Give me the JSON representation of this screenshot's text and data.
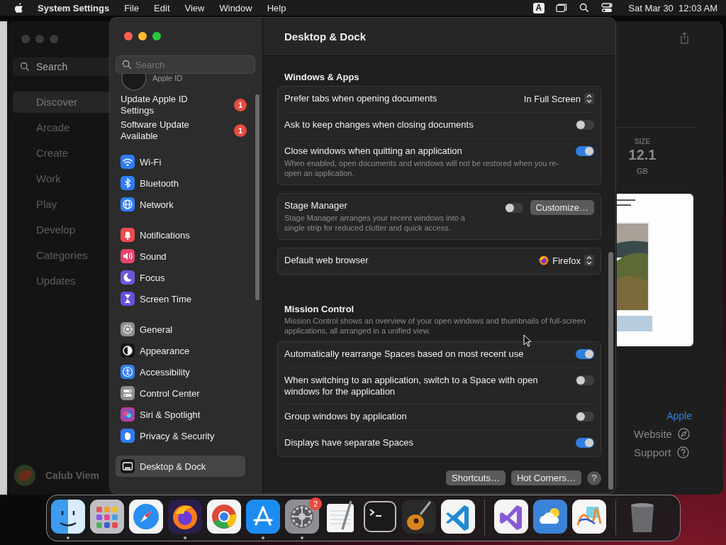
{
  "menu_bar": {
    "app": "System Settings",
    "menus": [
      "File",
      "Edit",
      "View",
      "Window",
      "Help"
    ],
    "input_source": "A",
    "clock": "Sat Mar 30  12:03 AM"
  },
  "background_window": {
    "search": {
      "placeholder": "Search"
    },
    "nav": [
      {
        "label": "Discover",
        "selected": true
      },
      {
        "label": "Arcade",
        "selected": false
      },
      {
        "label": "Create",
        "selected": false
      },
      {
        "label": "Work",
        "selected": false
      },
      {
        "label": "Play",
        "selected": false
      },
      {
        "label": "Develop",
        "selected": false
      },
      {
        "label": "Categories",
        "selected": false
      },
      {
        "label": "Updates",
        "selected": false
      }
    ],
    "user": "Calub Viem",
    "size_label": "SIZE",
    "size_value": "12.1",
    "size_unit": "GB",
    "developer": "Apple",
    "links": [
      "Website",
      "Support"
    ]
  },
  "settings": {
    "search": {
      "placeholder": "Search"
    },
    "account": "Apple ID",
    "alerts": [
      {
        "label": "Update Apple ID Settings",
        "badge": "1"
      },
      {
        "label": "Software Update Available",
        "badge": "1"
      }
    ],
    "groups": [
      [
        {
          "kind": "wifi",
          "label": "Wi-Fi",
          "color": "#2f7cf6",
          "selected": false
        },
        {
          "kind": "bluetooth",
          "label": "Bluetooth",
          "color": "#2f7cf6",
          "selected": false
        },
        {
          "kind": "network",
          "label": "Network",
          "color": "#2f7cf6",
          "selected": false
        }
      ],
      [
        {
          "kind": "notifications",
          "label": "Notifications",
          "color": "#ee4b4b",
          "selected": false
        },
        {
          "kind": "sound",
          "label": "Sound",
          "color": "#e8436a",
          "selected": false
        },
        {
          "kind": "focus",
          "label": "Focus",
          "color": "#6a5ad9",
          "selected": false
        },
        {
          "kind": "screen_time",
          "label": "Screen Time",
          "color": "#6a4fd9",
          "selected": false
        }
      ],
      [
        {
          "kind": "general",
          "label": "General",
          "color": "#8e8e93",
          "selected": false
        },
        {
          "kind": "appearance",
          "label": "Appearance",
          "color": "#161616",
          "selected": false
        },
        {
          "kind": "accessibility",
          "label": "Accessibility",
          "color": "#2f7cf6",
          "selected": false
        },
        {
          "kind": "control_center",
          "label": "Control Center",
          "color": "#8e8e93",
          "selected": false
        },
        {
          "kind": "siri",
          "label": "Siri & Spotlight",
          "color": "#b8409e",
          "selected": false
        },
        {
          "kind": "privacy",
          "label": "Privacy & Security",
          "color": "#2f7cf6",
          "selected": false
        }
      ],
      [
        {
          "kind": "desktop_dock",
          "label": "Desktop & Dock",
          "color": "#161616",
          "selected": true
        }
      ]
    ],
    "title": "Desktop & Dock",
    "sections": [
      {
        "heading": "Windows & Apps",
        "cards": [
          [
            {
              "kind": "popup",
              "label": "Prefer tabs when opening documents",
              "value": "In Full Screen"
            },
            {
              "kind": "toggle",
              "label": "Ask to keep changes when closing documents",
              "on": false
            },
            {
              "kind": "toggle",
              "label": "Close windows when quitting an application",
              "description": "When enabled, open documents and windows will not be restored when you re-open an application.",
              "on": true
            }
          ],
          [
            {
              "kind": "toggle",
              "label": "Stage Manager",
              "description": "Stage Manager arranges your recent windows into a single strip for reduced clutter and quick access.",
              "on": false,
              "button": "Customize…"
            }
          ],
          [
            {
              "kind": "app_popup",
              "label": "Default web browser",
              "value": "Firefox"
            }
          ]
        ]
      },
      {
        "heading": "Mission Control",
        "description": "Mission Control shows an overview of your open windows and thumbnails of full-screen applications, all arranged in a unified view.",
        "cards": [
          [
            {
              "kind": "toggle",
              "label": "Automatically rearrange Spaces based on most recent use",
              "on": true
            },
            {
              "kind": "toggle",
              "label": "When switching to an application, switch to a Space with open windows for the application",
              "on": false
            },
            {
              "kind": "toggle",
              "label": "Group windows by application",
              "on": false
            },
            {
              "kind": "toggle",
              "label": "Displays have separate Spaces",
              "on": true
            }
          ]
        ]
      }
    ],
    "footer_buttons": [
      "Shortcuts…",
      "Hot Corners…"
    ],
    "help": "?"
  },
  "dock": [
    [
      {
        "kind": "finder",
        "running": true
      },
      {
        "kind": "launchpad",
        "running": false
      },
      {
        "kind": "safari",
        "running": false
      },
      {
        "kind": "firefox",
        "running": true
      },
      {
        "kind": "chrome",
        "running": false
      },
      {
        "kind": "appstore",
        "running": true
      },
      {
        "kind": "settings",
        "running": true,
        "badge": "2"
      },
      {
        "kind": "textedit",
        "running": false
      },
      {
        "kind": "terminal",
        "running": false
      },
      {
        "kind": "garageband",
        "running": false
      },
      {
        "kind": "vscode",
        "running": false
      }
    ],
    [
      {
        "kind": "visualstudio",
        "running": false
      },
      {
        "kind": "weather",
        "running": false
      },
      {
        "kind": "freeform",
        "running": false
      }
    ],
    [
      {
        "kind": "trash",
        "running": false
      }
    ]
  ]
}
